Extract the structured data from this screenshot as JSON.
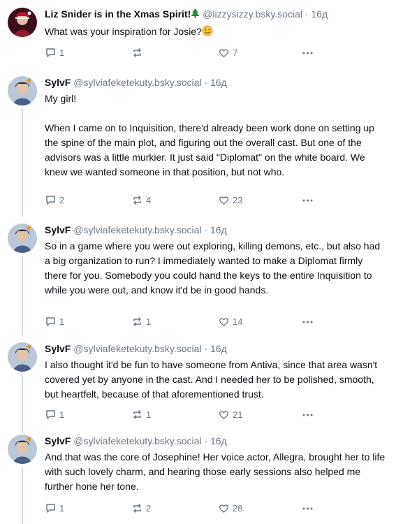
{
  "posts": [
    {
      "name": "Liz Snider is in the Xmas Spirit!",
      "handle": "@lizzysizzy.bsky.social",
      "dot": "·",
      "time": "16д",
      "text": "What was your inspiration for Josie?",
      "replies": "1",
      "reposts": "",
      "likes": "7",
      "avatar_color": "#6a1f2b"
    },
    {
      "name": "SylvF",
      "handle": "@sylviafeketekuty.bsky.social",
      "dot": "·",
      "time": "16д",
      "text": "My girl!\n\nWhen I came on to Inquisition, there'd already been work done on setting up the spine of the main plot, and figuring out the overall cast. But one of the advisors was a little murkier. It just said \"Diplomat\" on the white board. We knew we wanted someone in that position, but not who.",
      "replies": "2",
      "reposts": "4",
      "likes": "23",
      "avatar_color": "#7f8fa3"
    },
    {
      "name": "SylvF",
      "handle": "@sylviafeketekuty.bsky.social",
      "dot": "·",
      "time": "16д",
      "text": "So in a game where you were out exploring, killing demons, etc., but also had a big organization to run? I immediately wanted to make a Diplomat firmly there for you. Somebody you could hand the keys to the entire Inquisition to while you were out, and know it'd be in good hands.",
      "replies": "1",
      "reposts": "1",
      "likes": "14",
      "avatar_color": "#7f8fa3"
    },
    {
      "name": "SylvF",
      "handle": "@sylviafeketekuty.bsky.social",
      "dot": "·",
      "time": "16д",
      "text": "I also thought it'd be fun to have someone from Antiva, since that area wasn't covered yet by anyone in the cast. And I needed her to be polished, smooth, but heartfelt, because of that aforementioned trust.",
      "replies": "1",
      "reposts": "1",
      "likes": "21",
      "avatar_color": "#7f8fa3"
    },
    {
      "name": "SylvF",
      "handle": "@sylviafeketekuty.bsky.social",
      "dot": "·",
      "time": "16д",
      "text": "And that was the core of Josephine! Her voice actor, Allegra, brought her to life with such lovely charm, and hearing those early sessions also helped me further hone her tone.",
      "replies": "1",
      "reposts": "2",
      "likes": "28",
      "avatar_color": "#7f8fa3"
    }
  ],
  "icons": {
    "reply": "reply-icon",
    "repost": "repost-icon",
    "like": "heart-icon",
    "more": "more-icon",
    "tree": "christmas-tree-emoji",
    "smile": "smiling-face-emoji"
  },
  "colors": {
    "text": "#0b0f14",
    "muted": "#6b7787",
    "thread_line": "#d4dbe2"
  }
}
